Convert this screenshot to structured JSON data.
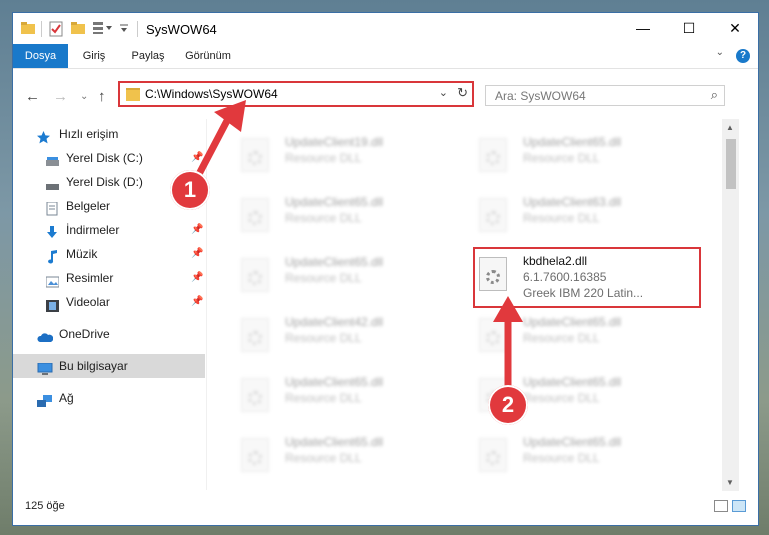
{
  "window": {
    "title": "SysWOW64",
    "controls": {
      "minimize": "—",
      "maximize": "☐",
      "close": "✕"
    }
  },
  "ribbon": {
    "tabs": [
      {
        "label": "Dosya",
        "active": true
      },
      {
        "label": "Giriş"
      },
      {
        "label": "Paylaş"
      },
      {
        "label": "Görünüm"
      }
    ],
    "help": "?"
  },
  "address": {
    "path": "C:\\Windows\\SysWOW64",
    "search_placeholder": "Ara: SysWOW64"
  },
  "sidebar": {
    "quick_access": "Hızlı erişim",
    "items": [
      {
        "label": "Yerel Disk (C:)",
        "icon": "drive-icon",
        "pinned": true
      },
      {
        "label": "Yerel Disk (D:)",
        "icon": "drive-icon",
        "pinned": false
      },
      {
        "label": "Belgeler",
        "icon": "documents-icon",
        "pinned": true
      },
      {
        "label": "İndirmeler",
        "icon": "download-icon",
        "pinned": true
      },
      {
        "label": "Müzik",
        "icon": "music-icon",
        "pinned": true
      },
      {
        "label": "Resimler",
        "icon": "pictures-icon",
        "pinned": true
      },
      {
        "label": "Videolar",
        "icon": "videos-icon",
        "pinned": true
      }
    ],
    "onedrive": "OneDrive",
    "this_pc": "Bu bilgisayar",
    "network": "Ağ"
  },
  "files": {
    "left_column": [
      {
        "name": "UpdateClient19.dll",
        "type": "Resource DLL"
      },
      {
        "name": "UpdateClient65.dll",
        "type": "Resource DLL"
      },
      {
        "name": "UpdateClient65.dll",
        "type": "Resource DLL"
      },
      {
        "name": "UpdateClient42.dll",
        "type": "Resource DLL"
      },
      {
        "name": "UpdateClient65.dll",
        "type": "Resource DLL"
      },
      {
        "name": "UpdateClient65.dll",
        "type": "Resource DLL"
      }
    ],
    "right_column": [
      {
        "name": "UpdateClient65.dll",
        "type": "Resource DLL"
      },
      {
        "name": "UpdateClient63.dll",
        "type": "Resource DLL"
      },
      {
        "name": "kbdhela2.dll",
        "type": "6.1.7600.16385",
        "desc": "Greek IBM 220 Latin...",
        "highlighted": true
      },
      {
        "name": "UpdateClient65.dll",
        "type": "Resource DLL"
      },
      {
        "name": "UpdateClient65.dll",
        "type": "Resource DLL"
      },
      {
        "name": "UpdateClient65.dll",
        "type": "Resource DLL"
      }
    ]
  },
  "status": {
    "count": "125 öğe"
  },
  "callouts": {
    "one": "1",
    "two": "2"
  },
  "colors": {
    "accent": "#1979ca",
    "highlight": "#d9363a"
  }
}
